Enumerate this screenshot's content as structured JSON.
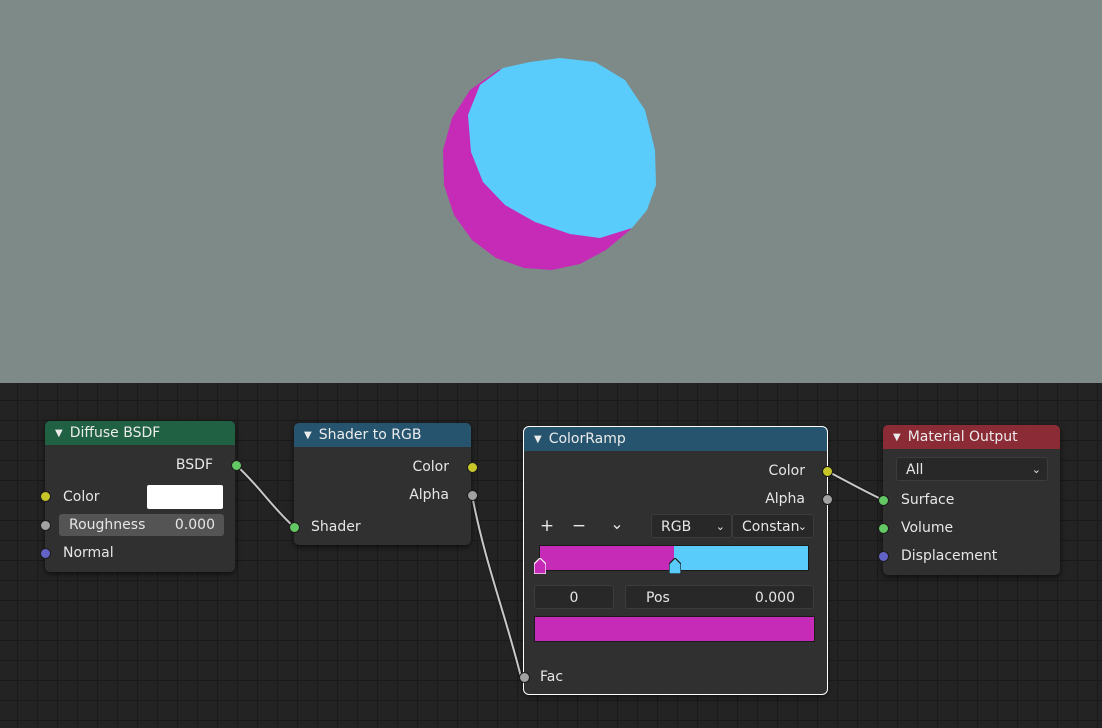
{
  "colors": {
    "viewport_bg": "#7d8a87",
    "magenta": "#c62bb8",
    "cyan": "#5accfb",
    "header_shader": "#1f6142",
    "header_converter": "#26546e",
    "header_output": "#8a2b35",
    "node_body": "#303030"
  },
  "nodes": {
    "diffuse": {
      "title": "Diffuse BSDF",
      "output_bsdf": "BSDF",
      "input_color": "Color",
      "input_roughness": "Roughness",
      "roughness_value": "0.000",
      "input_normal": "Normal"
    },
    "shader_to_rgb": {
      "title": "Shader to RGB",
      "output_color": "Color",
      "output_alpha": "Alpha",
      "input_shader": "Shader"
    },
    "colorramp": {
      "title": "ColorRamp",
      "output_color": "Color",
      "output_alpha": "Alpha",
      "add_label": "+",
      "remove_label": "−",
      "menu_label": "⌄",
      "color_mode": "RGB",
      "interpolation": "Constan",
      "stop_index": "0",
      "pos_label": "Pos",
      "pos_value": "0.000",
      "input_fac": "Fac",
      "stops": [
        {
          "position": 0.0,
          "color": "#c62bb8"
        },
        {
          "position": 0.5,
          "color": "#5accfb"
        }
      ]
    },
    "material_output": {
      "title": "Material Output",
      "target": "All",
      "input_surface": "Surface",
      "input_volume": "Volume",
      "input_displacement": "Displacement"
    }
  }
}
